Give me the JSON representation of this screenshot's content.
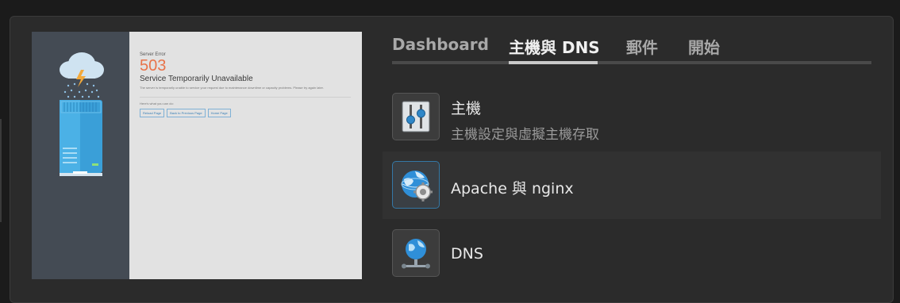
{
  "preview": {
    "error_label": "Server Error",
    "error_code": "503",
    "error_title": "Service Temporarily Unavailable",
    "error_description": "The server is temporarily unable to service your request due to maintenance downtime or capacity problems. Please try again later.",
    "help_text": "Here's what you can do:",
    "buttons": [
      "Reload Page",
      "Back to Previous Page",
      "Home Page"
    ]
  },
  "tabs": [
    {
      "label": "Dashboard",
      "active": false
    },
    {
      "label": "主機與 DNS",
      "active": true
    },
    {
      "label": "郵件",
      "active": false
    },
    {
      "label": "開始",
      "active": false
    }
  ],
  "items": [
    {
      "title": "主機",
      "description": "主機設定與虛擬主機存取",
      "icon": "sliders-icon"
    },
    {
      "title": "Apache 與 nginx",
      "description": "",
      "icon": "globe-gear-icon"
    },
    {
      "title": "DNS",
      "description": "",
      "icon": "globe-network-icon"
    }
  ],
  "colors": {
    "background": "#1b1b1b",
    "panel": "#2b2b2b",
    "error_code": "#e8734a",
    "active_border": "#3478a6"
  }
}
